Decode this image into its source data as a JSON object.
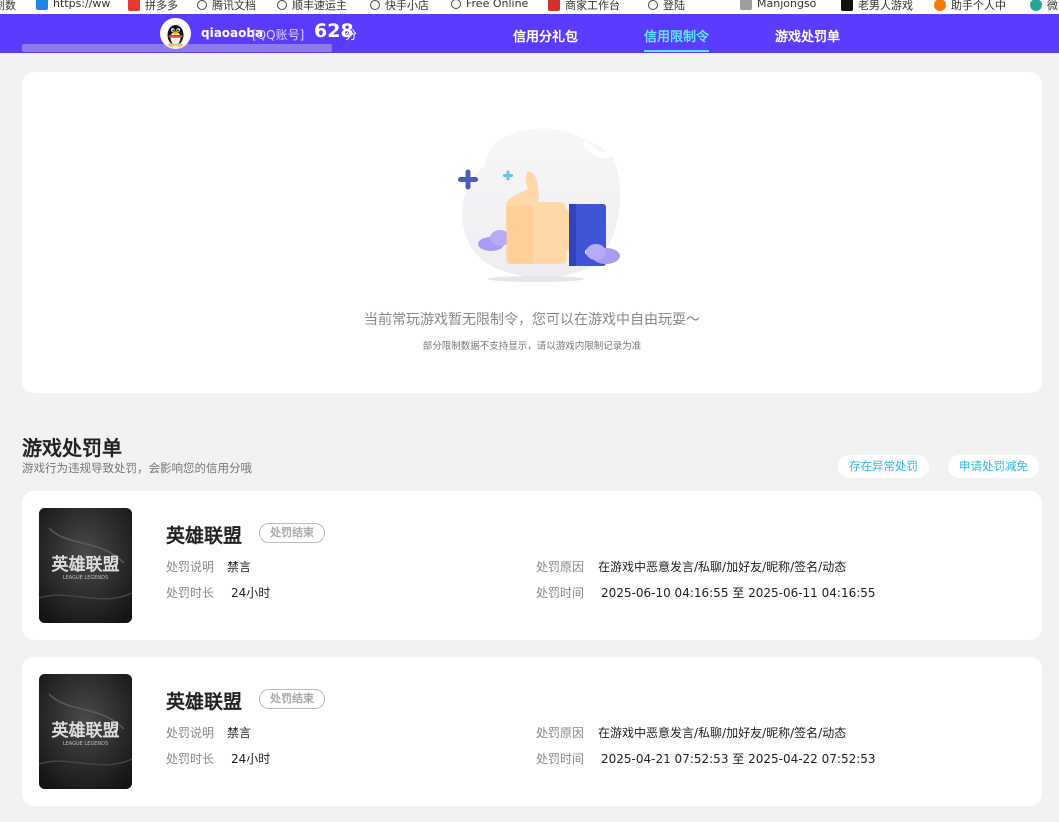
{
  "bookmarks": [
    {
      "label": "剧数",
      "color": "#e0e0e0"
    },
    {
      "label": "https://ww",
      "color": "#1e88e5"
    },
    {
      "label": "拼多多",
      "color": "#e53935"
    },
    {
      "label": "腾讯文档",
      "color": "globe"
    },
    {
      "label": "顺丰速运主",
      "color": "globe"
    },
    {
      "label": "快手小店",
      "color": "globe"
    },
    {
      "label": "Free Online",
      "color": "globe"
    },
    {
      "label": "商家工作台",
      "color": "#d32f2f"
    },
    {
      "label": "登陆",
      "color": "globe"
    },
    {
      "label": "Manjongso",
      "color": "#9e9e9e"
    },
    {
      "label": "老男人游戏",
      "color": "#111111"
    },
    {
      "label": "助手个人中",
      "color": "#f57c00"
    },
    {
      "label": "微",
      "color": "#26a69a"
    }
  ],
  "header": {
    "user_name": "qiaoaoba",
    "account_type": "[QQ账号]",
    "score": "628",
    "score_unit": "分",
    "nav": [
      {
        "label": "信用分礼包",
        "active": false
      },
      {
        "label": "信用限制令",
        "active": true
      },
      {
        "label": "游戏处罚单",
        "active": false
      }
    ]
  },
  "empty_state": {
    "title": "当前常玩游戏暂无限制令，您可以在游戏中自由玩耍～",
    "subtitle": "部分限制数据不支持显示，请以游戏内限制记录为准"
  },
  "penalty_section": {
    "title": "游戏处罚单",
    "subtitle": "游戏行为违规导致处罚，会影响您的信用分哦",
    "btn_abnormal": "存在异常处罚",
    "btn_reduce": "申请处罚减免",
    "label_desc": "处罚说明",
    "label_duration": "处罚时长",
    "label_reason": "处罚原因",
    "label_time": "处罚时间",
    "items": [
      {
        "game": "英雄联盟",
        "logo_cn": "英雄联盟",
        "logo_en": "LEAGUE LEGENDS",
        "status": "处罚结束",
        "desc": "禁言",
        "duration": "24小时",
        "reason": "在游戏中恶意发言/私聊/加好友/昵称/签名/动态",
        "time": "2025-06-10 04:16:55 至 2025-06-11 04:16:55"
      },
      {
        "game": "英雄联盟",
        "logo_cn": "英雄联盟",
        "logo_en": "LEAGUE LEGENDS",
        "status": "处罚结束",
        "desc": "禁言",
        "duration": "24小时",
        "reason": "在游戏中恶意发言/私聊/加好友/昵称/签名/动态",
        "time": "2025-04-21 07:52:53 至 2025-04-22 07:52:53"
      }
    ]
  },
  "colors": {
    "header_bg": "#5a3bff",
    "nav_active": "#5fe3ff",
    "link": "#2fb6e0"
  }
}
